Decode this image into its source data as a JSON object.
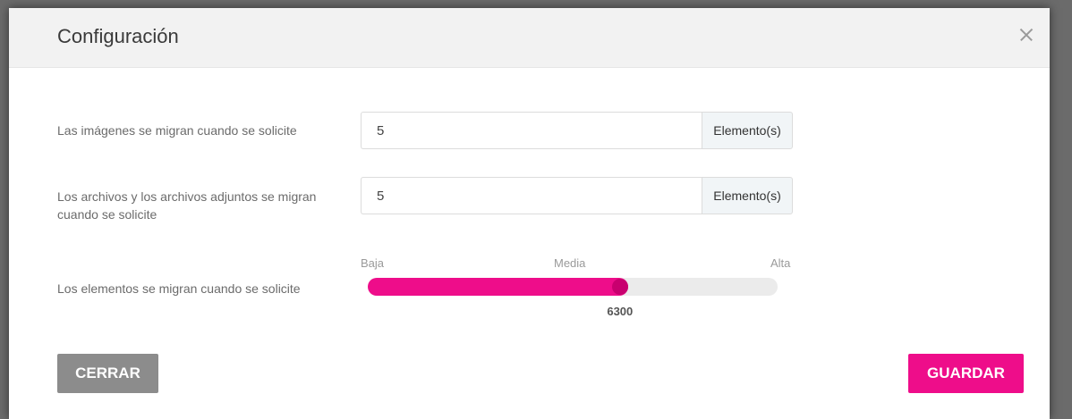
{
  "dialog": {
    "title": "Configuración"
  },
  "settings": {
    "images": {
      "label": "Las imágenes se migran cuando se solicite",
      "value": "5",
      "unit": "Elemento(s)"
    },
    "files": {
      "label": "Los archivos y los archivos adjuntos se migran cuando se solicite",
      "value": "5",
      "unit": "Elemento(s)"
    },
    "items": {
      "label": "Los elementos se migran cuando se solicite",
      "scale_low": "Baja",
      "scale_mid": "Media",
      "scale_high": "Alta",
      "value_label": "6300",
      "fill_fraction": 0.62
    }
  },
  "footer": {
    "close_label": "CERRAR",
    "save_label": "GUARDAR"
  },
  "colors": {
    "accent": "#ee0d8a",
    "thumb": "#c8006f",
    "close_button": "#8c8c8c"
  }
}
